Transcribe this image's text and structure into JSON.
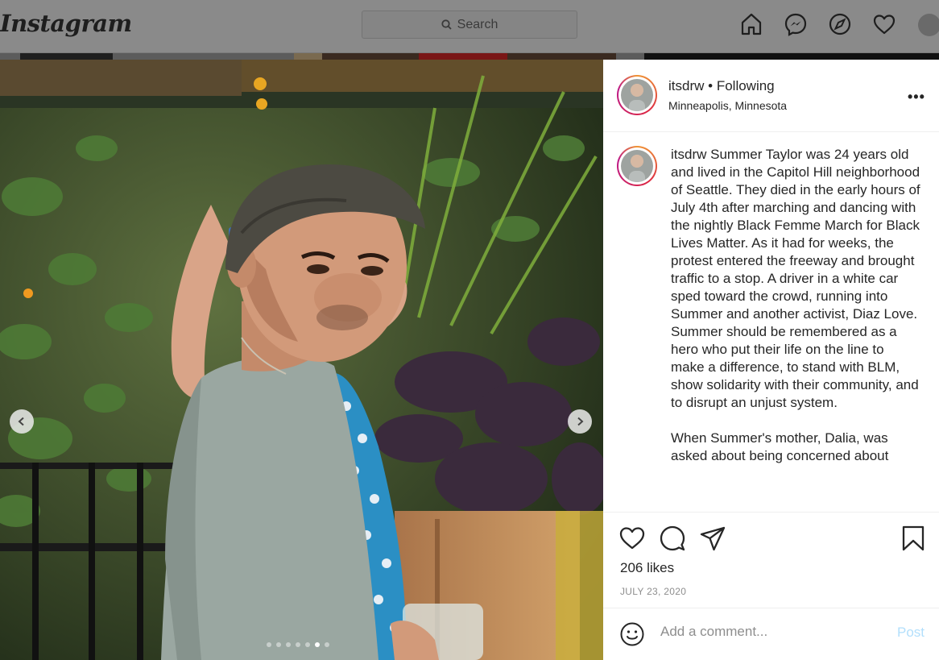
{
  "topbar": {
    "logo": "Instagram",
    "search_placeholder": "Search"
  },
  "post": {
    "username": "itsdrw",
    "follow_status": "Following",
    "separator": "•",
    "location": "Minneapolis, Minnesota",
    "more": "•••",
    "caption_username": "itsdrw",
    "caption_p1": "Summer Taylor was 24 years old and lived in the Capitol Hill neighborhood of Seattle. They died in the early hours of July 4th after marching and dancing with the nightly Black Femme March for Black Lives Matter. As it had for weeks, the protest entered the freeway and brought traffic to a stop. A driver in a white car sped toward the crowd, running into Summer and another activist, Diaz Love. Summer should be remembered as a hero who put their life on the line to make a difference, to stand with BLM, show solidarity with their community, and to disrupt an unjust system.",
    "caption_p2": "When Summer's mother, Dalia, was asked about being concerned about",
    "likes": "206 likes",
    "date": "JULY 23, 2020",
    "comment_placeholder": "Add a comment...",
    "post_button": "Post",
    "carousel": {
      "count": 7,
      "active_index": 5
    }
  },
  "icons": {
    "home": "home-icon",
    "messenger": "messenger-icon",
    "explore": "compass-icon",
    "activity": "heart-icon",
    "like": "heart-outline-icon",
    "comment": "comment-icon",
    "share": "paper-plane-icon",
    "save": "bookmark-icon",
    "emoji": "emoji-icon"
  },
  "colors": {
    "post_link": "#b2dffc",
    "text": "#262626",
    "muted": "#8e8e8e"
  }
}
